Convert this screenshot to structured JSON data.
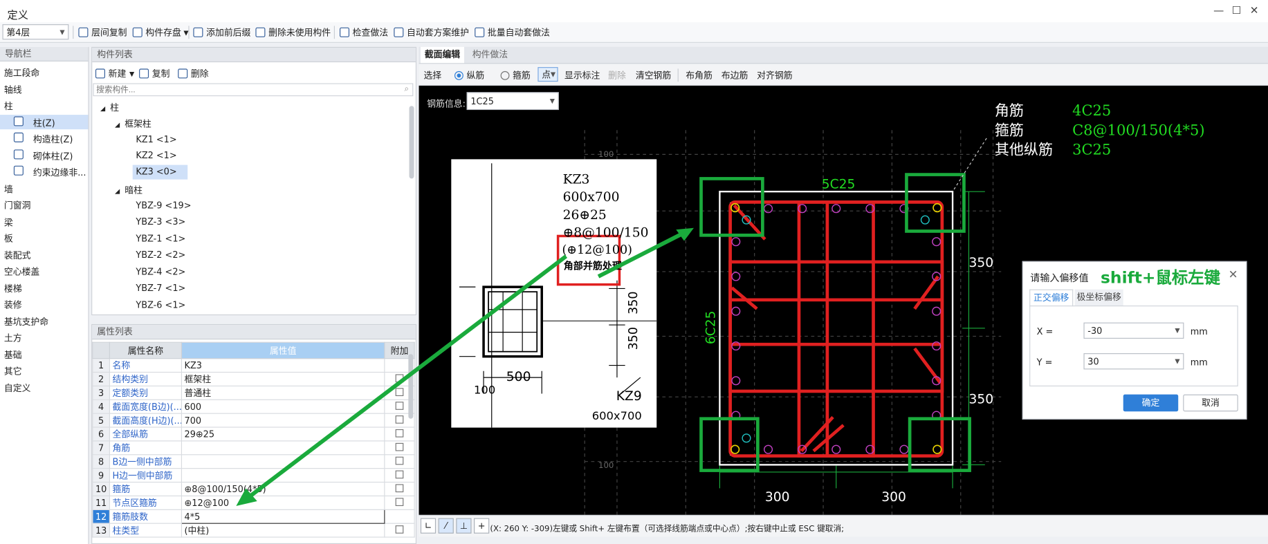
{
  "window": {
    "title": "定义"
  },
  "toolbar": {
    "floor_value": "第4层",
    "items": [
      "层间复制",
      "构件存盘",
      "添加前后缀",
      "删除未使用构件",
      "检查做法",
      "自动套方案维护",
      "批量自动套做法"
    ]
  },
  "nav": {
    "header": "导航栏",
    "items": [
      "施工段命",
      "轴线",
      "柱",
      "柱(Z)",
      "构造柱(Z)",
      "砌体柱(Z)",
      "约束边缘非...",
      "墙",
      "门窗洞",
      "梁",
      "板",
      "装配式",
      "空心楼盖",
      "楼梯",
      "装修",
      "基坑支护命",
      "土方",
      "基础",
      "其它",
      "自定义"
    ]
  },
  "component_list": {
    "header": "构件列表",
    "new_label": "新建",
    "copy_label": "复制",
    "delete_label": "删除",
    "search_placeholder": "搜索构件...",
    "tree": [
      "柱",
      "框架柱",
      "KZ1 <1>",
      "KZ2 <1>",
      "KZ3 <0>",
      "暗柱",
      "YBZ-9 <19>",
      "YBZ-3 <3>",
      "YBZ-1 <1>",
      "YBZ-2 <2>",
      "YBZ-4 <2>",
      "YBZ-7 <1>",
      "YBZ-6 <1>"
    ]
  },
  "properties": {
    "header": "属性列表",
    "columns": [
      "属性名称",
      "属性值",
      "附加"
    ],
    "rows": [
      {
        "n": "1",
        "name": "名称",
        "value": "KZ3"
      },
      {
        "n": "2",
        "name": "结构类别",
        "value": "框架柱"
      },
      {
        "n": "3",
        "name": "定额类别",
        "value": "普通柱"
      },
      {
        "n": "4",
        "name": "截面宽度(B边)(...",
        "value": "600"
      },
      {
        "n": "5",
        "name": "截面高度(H边)(...",
        "value": "700"
      },
      {
        "n": "6",
        "name": "全部纵筋",
        "value": "29⊕25"
      },
      {
        "n": "7",
        "name": "角筋",
        "value": ""
      },
      {
        "n": "8",
        "name": "B边一侧中部筋",
        "value": ""
      },
      {
        "n": "9",
        "name": "H边一侧中部筋",
        "value": ""
      },
      {
        "n": "10",
        "name": "箍筋",
        "value": "⊕8@100/150(4*5)"
      },
      {
        "n": "11",
        "name": "节点区箍筋",
        "value": "⊕12@100"
      },
      {
        "n": "12",
        "name": "箍筋肢数",
        "value": "4*5"
      },
      {
        "n": "13",
        "name": "柱类型",
        "value": "(中柱)"
      }
    ]
  },
  "canvas_tabs": [
    "截面编辑",
    "构件做法"
  ],
  "canvas_tools": {
    "select": "选择",
    "longitudinal": "纵筋",
    "stirrup": "箍筋",
    "point": "点",
    "show_mark": "显示标注",
    "delete": "删除",
    "clear": "清空钢筋",
    "corner": "布角筋",
    "edge": "布边筋",
    "align": "对齐钢筋"
  },
  "rebar_info": {
    "label": "钢筋信息:",
    "value": "1C25"
  },
  "drawing": {
    "legend_corner_label": "角筋",
    "legend_corner_value": "4C25",
    "legend_stirrup_label": "箍筋",
    "legend_stirrup_value": "C8@100/150(4*5)",
    "legend_other_label": "其他纵筋",
    "legend_other_value": "3C25",
    "top_bars": "5C25",
    "side_bars": "6C25",
    "dim_350_top": "350",
    "dim_350_bottom": "350",
    "dim_300_left": "300",
    "dim_300_right": "300",
    "grid_label_100": "100",
    "ref_title": "KZ3",
    "ref_size": "600x700",
    "ref_bars": "26⊕25",
    "ref_stirrup": "⊕8@100/150",
    "ref_node": "(⊕12@100)",
    "ref_note": "角部并筋处理",
    "ref_dim_500": "500",
    "ref_dim_100": "100",
    "ref_dim_350a": "350",
    "ref_dim_350b": "350",
    "ref_kz9": "KZ9",
    "ref_cut": "600x700"
  },
  "dialog": {
    "title": "请输入偏移值",
    "hint": "shift+鼠标左键",
    "tab_ortho": "正交偏移",
    "tab_polar": "极坐标偏移",
    "x_label": "X =",
    "x_value": "-30",
    "y_label": "Y =",
    "y_value": "30",
    "unit": "mm",
    "ok": "确定",
    "cancel": "取消"
  },
  "status": {
    "text": "(X: 260 Y: -309)左键或 Shift+ 左键布置（可选择线筋端点或中心点）;按右键中止或 ESC 键取消;"
  },
  "colors": {
    "accent": "#2f7fd8",
    "rebar_red": "#e02020",
    "highlight_green": "#1aaa3c",
    "label_green": "#22dd22",
    "selected_row": "#cfe0f8"
  }
}
